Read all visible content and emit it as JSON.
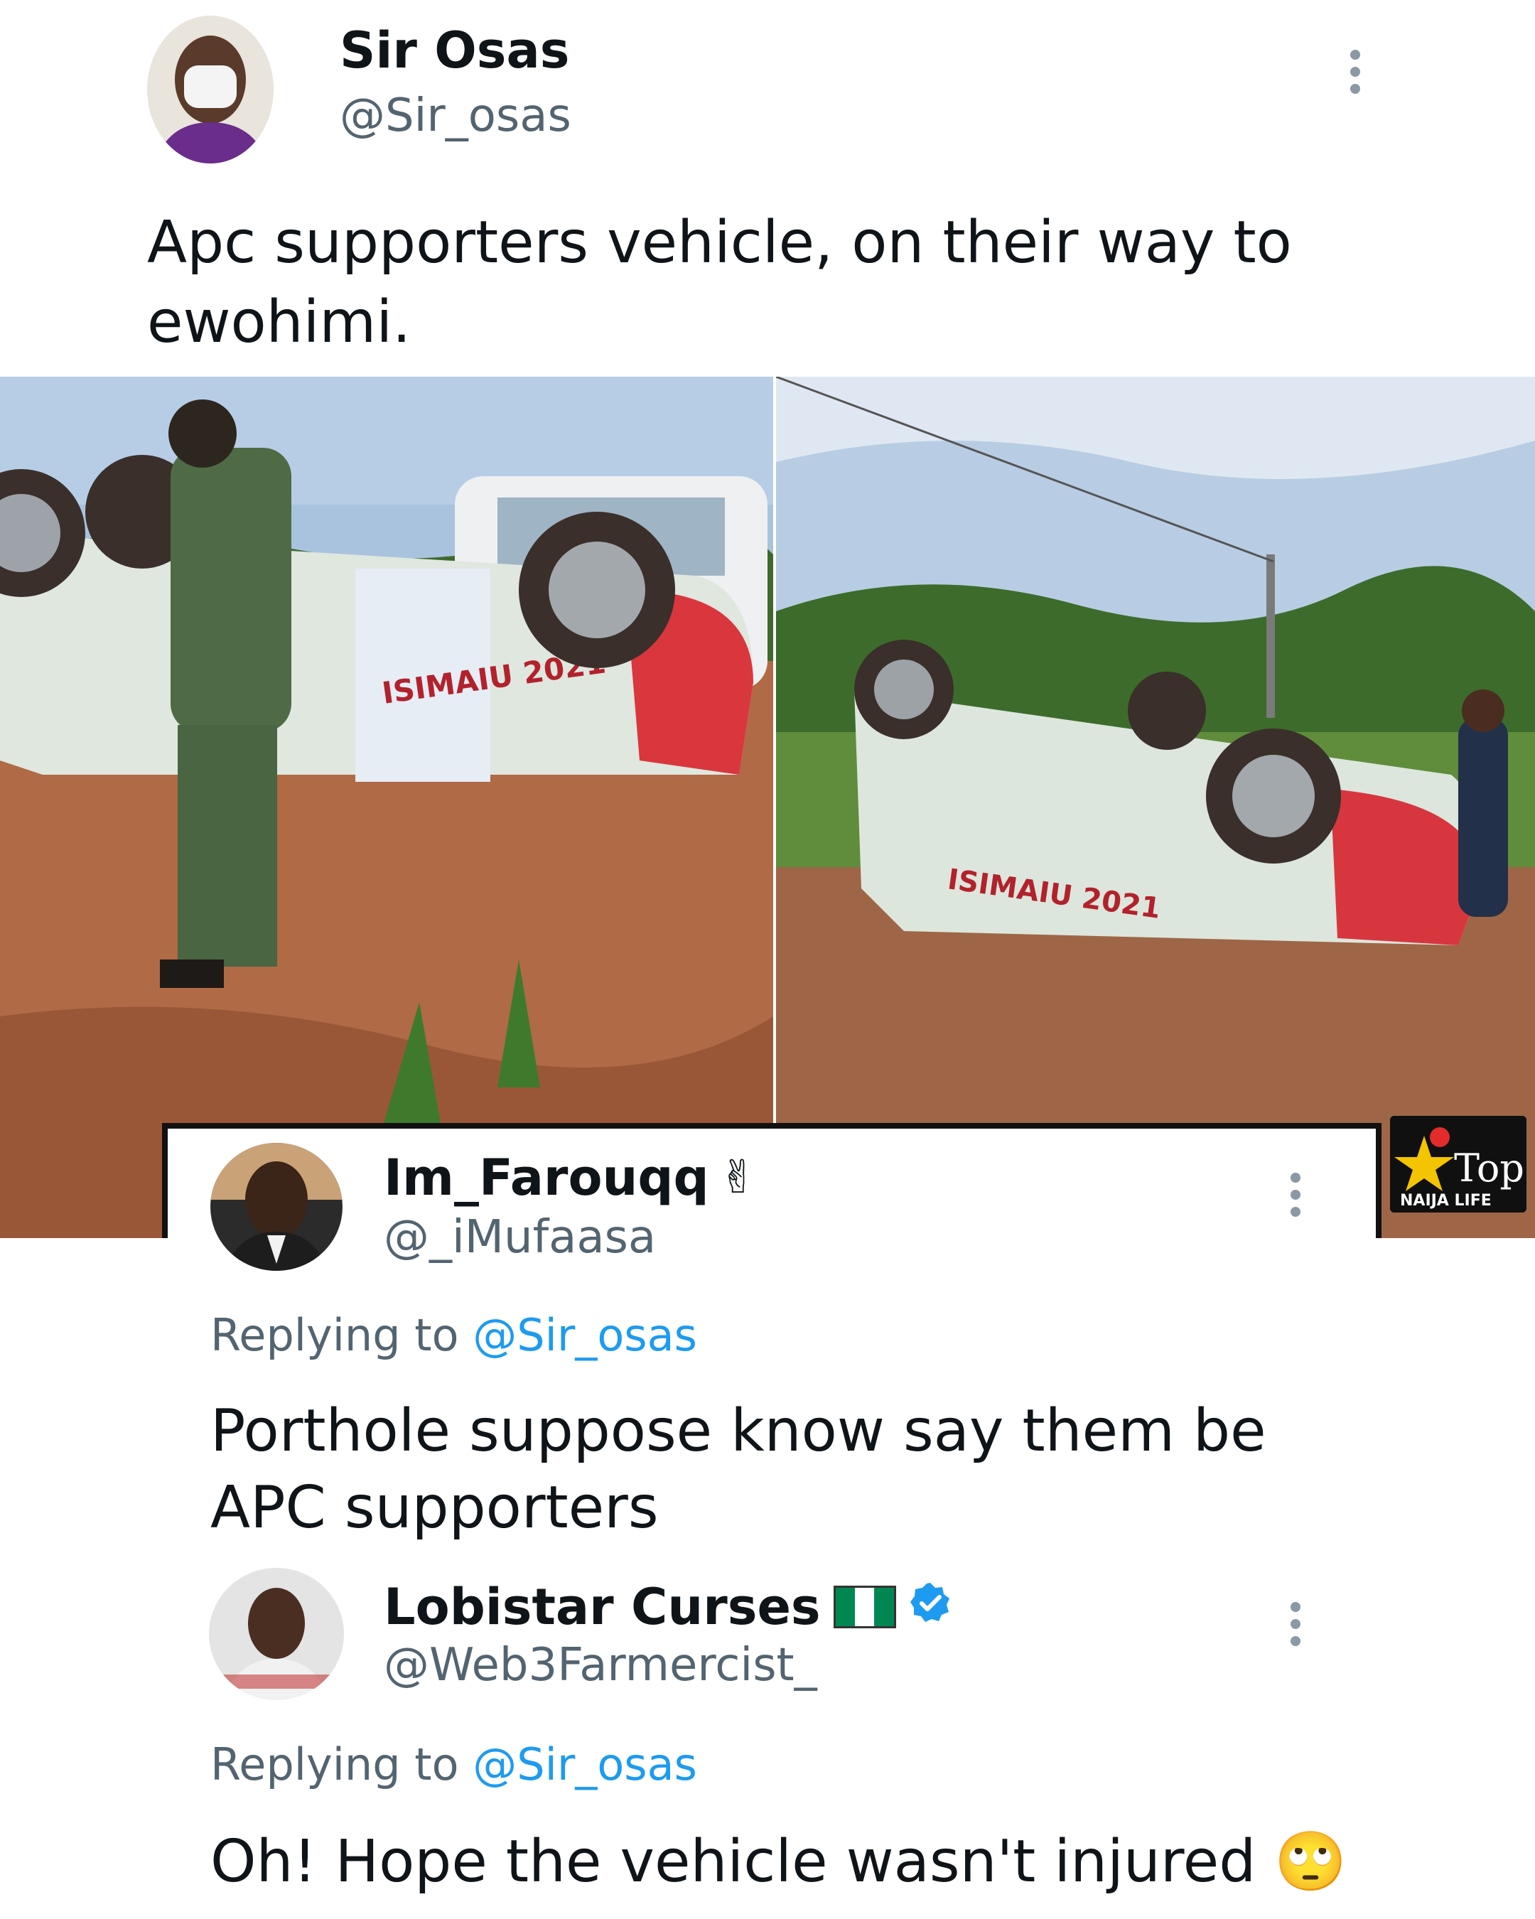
{
  "main_tweet": {
    "name": "Sir Osas",
    "handle": "@Sir_osas",
    "text": "Apc supporters vehicle, on their way to ewohimi."
  },
  "photos": [
    {
      "icon": "overturned-car-photo-left"
    },
    {
      "icon": "overturned-car-photo-right"
    }
  ],
  "vehicle_sign": {
    "text": "ISIMAIU 2021",
    "party": "APC"
  },
  "watermark": {
    "title": "Top",
    "subtitle": "NAIJA LIFE"
  },
  "reply1": {
    "name": "Im_Farouqq",
    "emoji": "✌",
    "handle": "@_iMufaasa",
    "replying_prefix": "Replying to",
    "replying_to": "@Sir_osas",
    "text": "Porthole suppose know say them be APC supporters"
  },
  "reply2": {
    "name": "Lobistar Curses",
    "handle": "@Web3Farmercist_",
    "replying_prefix": "Replying to",
    "replying_to": "@Sir_osas",
    "text": "Oh! Hope the vehicle wasn't injured",
    "emoji": "🙄"
  },
  "colors": {
    "link": "#1d9bf0",
    "verified": "#1d9bf0",
    "flag_green": "#008751"
  }
}
